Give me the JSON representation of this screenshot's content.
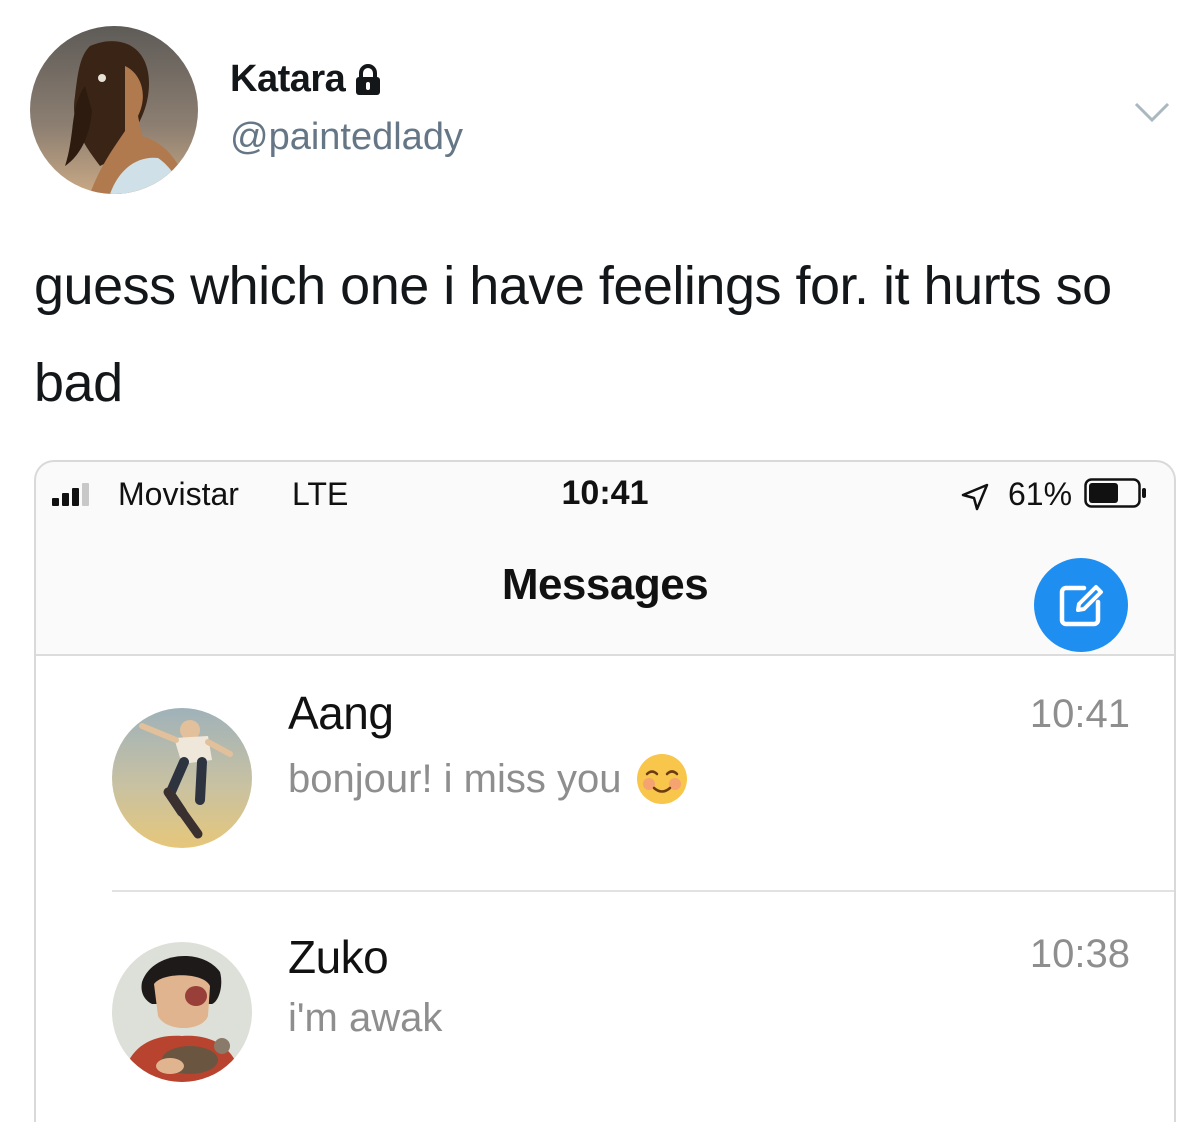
{
  "tweet": {
    "display_name": "Katara",
    "handle": "@paintedlady",
    "text": "guess which one i have feelings for. it hurts so bad",
    "icons": {
      "avatar": "katara-avatar",
      "lock": "lock-icon",
      "menu": "chevron-down-icon"
    }
  },
  "phone": {
    "status_bar": {
      "carrier": "Movistar",
      "network": "LTE",
      "time": "10:41",
      "battery_percent": "61%",
      "battery_level": 0.61,
      "icons": [
        "signal-icon",
        "location-icon",
        "battery-icon"
      ]
    },
    "nav": {
      "title": "Messages",
      "compose_icon": "compose-icon"
    },
    "conversations": [
      {
        "name": "Aang",
        "preview": "bonjour! i miss you",
        "preview_emoji": "smiling-face-icon",
        "time": "10:41",
        "avatar": "aang-avatar"
      },
      {
        "name": "Zuko",
        "preview": "i'm awak",
        "time": "10:38",
        "avatar": "zuko-avatar"
      }
    ]
  },
  "colors": {
    "accent_blue": "#1f8ef1",
    "handle_gray": "#657786",
    "preview_gray": "#8e8e8e",
    "text": "#14171a"
  }
}
